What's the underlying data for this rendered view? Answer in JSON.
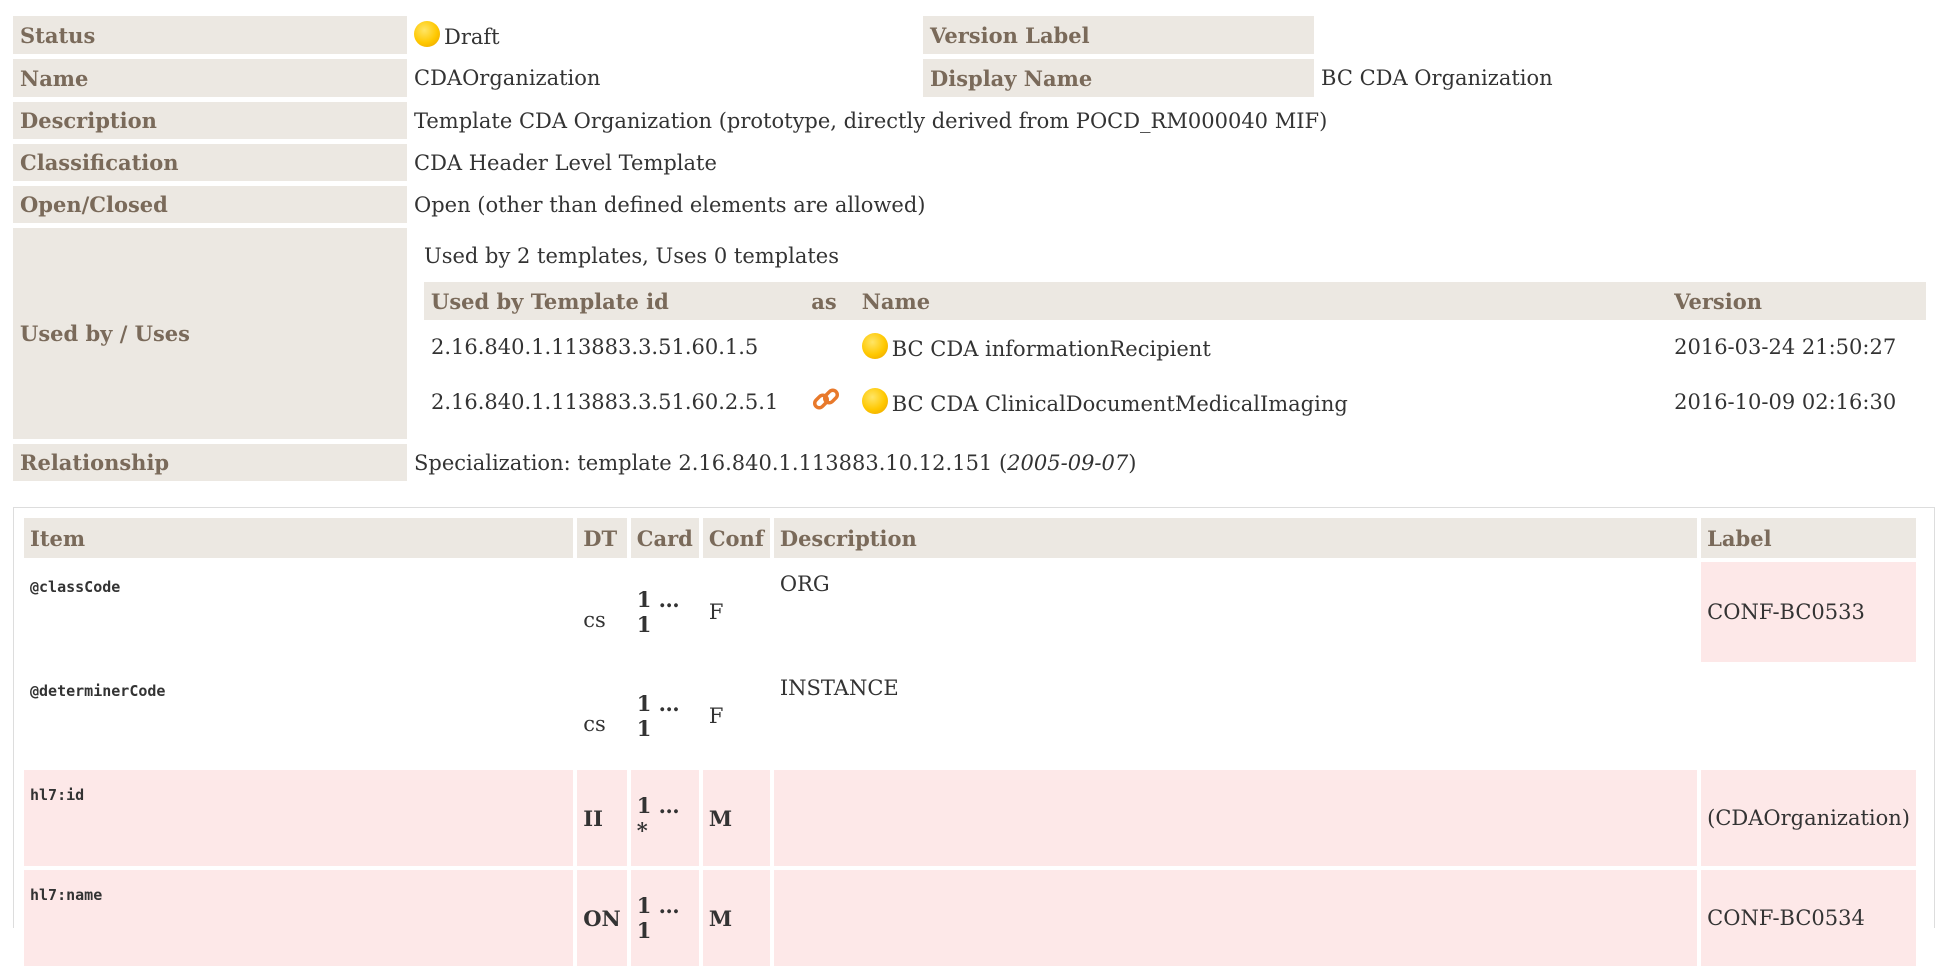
{
  "template": {
    "status_label": "Status",
    "status_value": "Draft",
    "version_label_label": "Version Label",
    "version_label_value": "",
    "name_label": "Name",
    "name_value": "CDAOrganization",
    "display_name_label": "Display Name",
    "display_name_value": "BC CDA Organization",
    "description_label": "Description",
    "description_value": "Template CDA Organization (prototype, directly derived from POCD_RM000040 MIF)",
    "classification_label": "Classification",
    "classification_value": "CDA Header Level Template",
    "open_closed_label": "Open/Closed",
    "open_closed_value": "Open (other than defined elements are allowed)",
    "used_by_label": "Used by / Uses",
    "used_by_summary": "Used by 2 templates, Uses 0 templates",
    "relationship_label": "Relationship",
    "relationship_prefix": "Specialization: template 2.16.840.1.113883.10.12.151 (",
    "relationship_date": "2005-09-07",
    "relationship_suffix": ")"
  },
  "used_by": {
    "headers": [
      "Used by Template id",
      "as",
      "Name",
      "Version"
    ],
    "rows": [
      {
        "id": "2.16.840.1.113883.3.51.60.1.5",
        "as": "",
        "name": "BC CDA informationRecipient",
        "version": "2016-03-24 21:50:27",
        "status": "draft",
        "link": false
      },
      {
        "id": "2.16.840.1.113883.3.51.60.2.5.1",
        "as": "link-icon",
        "name": "BC CDA ClinicalDocumentMedicalImaging",
        "version": "2016-10-09 02:16:30",
        "status": "draft",
        "link": true
      }
    ]
  },
  "design": {
    "headers": [
      "Item",
      "DT",
      "Card",
      "Conf",
      "Description",
      "Label"
    ],
    "rows": [
      {
        "item": "@classCode",
        "dt": "cs",
        "card": "1 … 1",
        "conf": "F",
        "description": "ORG",
        "label": "CONF-BC0533",
        "highlight": false,
        "label_highlight": true
      },
      {
        "item": "@determinerCode",
        "dt": "cs",
        "card": "1 … 1",
        "conf": "F",
        "description": "INSTANCE",
        "label": "",
        "highlight": false,
        "label_highlight": false
      },
      {
        "item": "hl7:id",
        "dt": "II",
        "card": "1 … *",
        "conf": "M",
        "description": "",
        "label": "(CDAOrganization)",
        "highlight": true,
        "label_highlight": true
      },
      {
        "item": "hl7:name",
        "dt": "ON",
        "card": "1 … 1",
        "conf": "M",
        "description": "",
        "label": "CONF-BC0534",
        "highlight": true,
        "label_highlight": true
      }
    ]
  },
  "colors": {
    "header_bg": "#ece8e2",
    "header_text": "#7a6a5a",
    "highlight_bg": "#fde8e8",
    "status_draft": "#ffc800",
    "link_icon": "#e8792b"
  }
}
